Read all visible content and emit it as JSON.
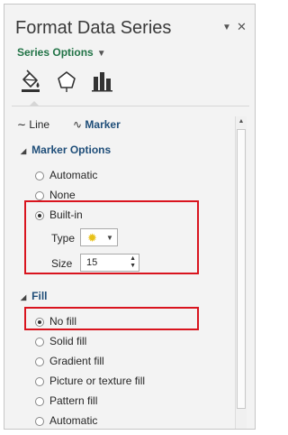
{
  "pane": {
    "title": "Format Data Series",
    "dropdown_glyph": "▼",
    "close_glyph": "✕"
  },
  "series_options": {
    "label": "Series Options",
    "caret": "▼"
  },
  "icon_tabs": [
    {
      "name": "fill-line-icon",
      "active": true
    },
    {
      "name": "effects-icon",
      "active": false
    },
    {
      "name": "series-options-icon",
      "active": false
    }
  ],
  "sub_tabs": {
    "line": "Line",
    "marker": "Marker",
    "line_glyph": "∼",
    "marker_glyph": "∿"
  },
  "marker_options": {
    "heading": "Marker Options",
    "collapse_glyph": "◢",
    "options": [
      {
        "label": "Automatic",
        "selected": false
      },
      {
        "label": "None",
        "selected": false
      },
      {
        "label": "Built-in",
        "selected": true
      }
    ],
    "type_label": "Type",
    "type_star": "✹",
    "type_arrow": "▼",
    "size_label": "Size",
    "size_value": "15",
    "spin_up": "▲",
    "spin_down": "▼"
  },
  "fill": {
    "heading": "Fill",
    "collapse_glyph": "◢",
    "options": [
      {
        "label": "No fill",
        "selected": true
      },
      {
        "label": "Solid fill",
        "selected": false
      },
      {
        "label": "Gradient fill",
        "selected": false
      },
      {
        "label": "Picture or texture fill",
        "selected": false
      },
      {
        "label": "Pattern fill",
        "selected": false
      },
      {
        "label": "Automatic",
        "selected": false
      }
    ]
  },
  "scrollbar": {
    "up": "▲"
  },
  "colors": {
    "accent_green": "#217346",
    "heading_blue": "#1f4e79",
    "highlight_red": "#d9141e",
    "marker_yellow": "#e8c21a"
  }
}
